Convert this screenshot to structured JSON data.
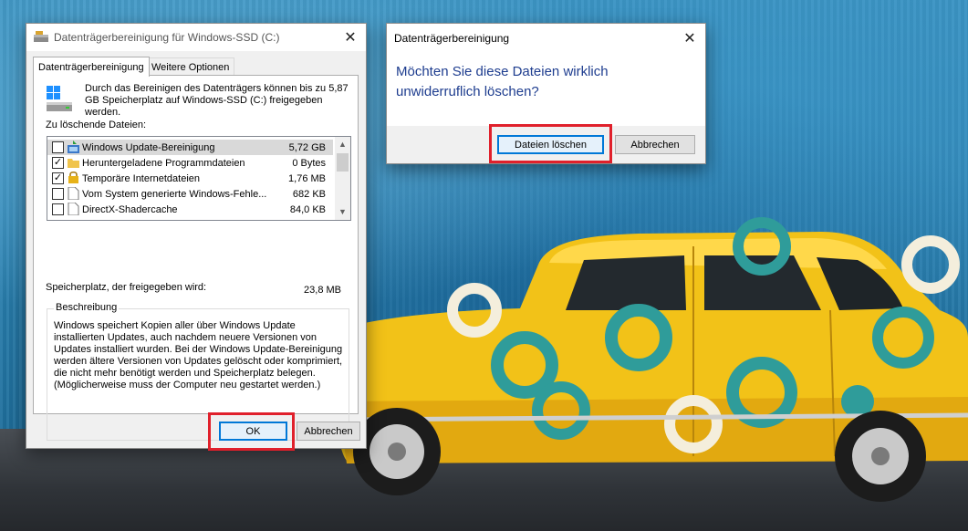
{
  "cleanup_window": {
    "title": "Datenträgerbereinigung für Windows-SSD (C:)",
    "tabs": [
      {
        "label": "Datenträgerbereinigung",
        "active": true
      },
      {
        "label": "Weitere Optionen",
        "active": false
      }
    ],
    "intro_text": "Durch das Bereinigen des Datenträgers können bis zu 5,87 GB Speicherplatz auf Windows-SSD (C:) freigegeben werden.",
    "files_label": "Zu löschende Dateien:",
    "files": [
      {
        "name": "Windows Update-Bereinigung",
        "size": "5,72 GB",
        "checked": false,
        "icon": "windows-update-icon",
        "selected": true
      },
      {
        "name": "Heruntergeladene Programmdateien",
        "size": "0 Bytes",
        "checked": true,
        "icon": "folder-icon",
        "selected": false
      },
      {
        "name": "Temporäre Internetdateien",
        "size": "1,76 MB",
        "checked": true,
        "icon": "lock-icon",
        "selected": false
      },
      {
        "name": "Vom System generierte Windows-Fehle...",
        "size": "682 KB",
        "checked": false,
        "icon": "file-icon",
        "selected": false
      },
      {
        "name": "DirectX-Shadercache",
        "size": "84,0 KB",
        "checked": false,
        "icon": "file-icon",
        "selected": false
      }
    ],
    "space_label": "Speicherplatz, der freigegeben wird:",
    "space_value": "23,8 MB",
    "description_legend": "Beschreibung",
    "description_text": "Windows speichert Kopien aller über Windows Update installierten Updates, auch nachdem neuere Versionen von Updates installiert wurden. Bei der Windows Update-Bereinigung werden ältere Versionen von Updates gelöscht oder komprimiert, die nicht mehr benötigt werden und Speicherplatz belegen. (Möglicherweise muss der Computer neu gestartet werden.)",
    "ok_label": "OK",
    "cancel_label": "Abbrechen"
  },
  "confirm_window": {
    "title": "Datenträgerbereinigung",
    "question": "Möchten Sie diese Dateien wirklich unwiderruflich löschen?",
    "delete_label": "Dateien löschen",
    "cancel_label": "Abbrechen"
  },
  "colors": {
    "highlight_red": "#e0202b",
    "question_blue": "#1e3d8f",
    "car_yellow": "#f2c218",
    "car_ring_teal": "#2f9c9a",
    "wall_blue": "#2d84b4"
  }
}
